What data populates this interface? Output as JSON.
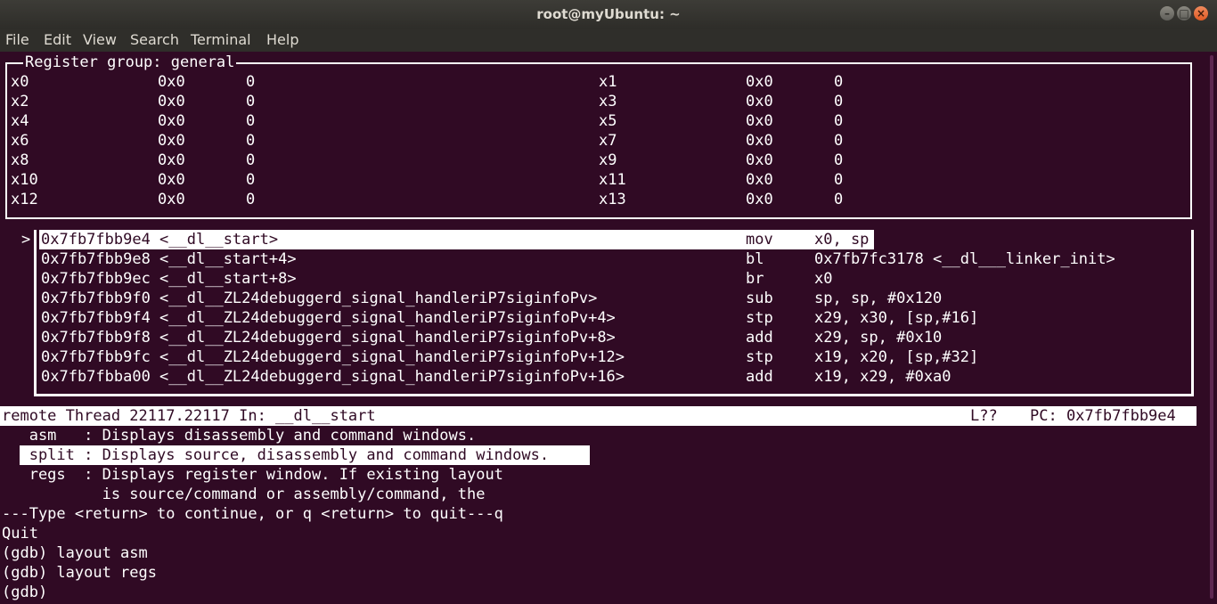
{
  "window": {
    "title": "root@myUbuntu: ~",
    "buttons": [
      "–",
      "□",
      "×"
    ]
  },
  "menu": [
    "File",
    "Edit",
    "View",
    "Search",
    "Terminal",
    "Help"
  ],
  "registers": {
    "title": "Register group: general",
    "rows": [
      {
        "l_name": "x0",
        "l_hex": "0x0",
        "l_dec": "0",
        "r_name": "x1",
        "r_hex": "0x0",
        "r_dec": "0"
      },
      {
        "l_name": "x2",
        "l_hex": "0x0",
        "l_dec": "0",
        "r_name": "x3",
        "r_hex": "0x0",
        "r_dec": "0"
      },
      {
        "l_name": "x4",
        "l_hex": "0x0",
        "l_dec": "0",
        "r_name": "x5",
        "r_hex": "0x0",
        "r_dec": "0"
      },
      {
        "l_name": "x6",
        "l_hex": "0x0",
        "l_dec": "0",
        "r_name": "x7",
        "r_hex": "0x0",
        "r_dec": "0"
      },
      {
        "l_name": "x8",
        "l_hex": "0x0",
        "l_dec": "0",
        "r_name": "x9",
        "r_hex": "0x0",
        "r_dec": "0"
      },
      {
        "l_name": "x10",
        "l_hex": "0x0",
        "l_dec": "0",
        "r_name": "x11",
        "r_hex": "0x0",
        "r_dec": "0"
      },
      {
        "l_name": "x12",
        "l_hex": "0x0",
        "l_dec": "0",
        "r_name": "x13",
        "r_hex": "0x0",
        "r_dec": "0"
      }
    ]
  },
  "asm": {
    "marker": ">",
    "rows": [
      {
        "addr": "0x7fb7fbb9e4 <__dl__start>",
        "op": "mov",
        "args": "x0, sp"
      },
      {
        "addr": "0x7fb7fbb9e8 <__dl__start+4>",
        "op": "bl",
        "args": "0x7fb7fc3178 <__dl___linker_init>"
      },
      {
        "addr": "0x7fb7fbb9ec <__dl__start+8>",
        "op": "br",
        "args": "x0"
      },
      {
        "addr": "0x7fb7fbb9f0 <__dl__ZL24debuggerd_signal_handleriP7siginfoPv>",
        "op": "sub",
        "args": "sp, sp, #0x120"
      },
      {
        "addr": "0x7fb7fbb9f4 <__dl__ZL24debuggerd_signal_handleriP7siginfoPv+4>",
        "op": "stp",
        "args": "x29, x30, [sp,#16]"
      },
      {
        "addr": "0x7fb7fbb9f8 <__dl__ZL24debuggerd_signal_handleriP7siginfoPv+8>",
        "op": "add",
        "args": "x29, sp, #0x10"
      },
      {
        "addr": "0x7fb7fbb9fc <__dl__ZL24debuggerd_signal_handleriP7siginfoPv+12>",
        "op": "stp",
        "args": "x19, x20, [sp,#32]"
      },
      {
        "addr": "0x7fb7fbba00 <__dl__ZL24debuggerd_signal_handleriP7siginfoPv+16>",
        "op": "add",
        "args": "x19, x29, #0xa0"
      }
    ]
  },
  "status": {
    "left": "remote Thread 22117.22117 In: __dl__start",
    "line": "L??",
    "pc": "PC: 0x7fb7fbb9e4"
  },
  "console": [
    "   asm   : Displays disassembly and command windows.",
    "   split : Displays source, disassembly and command windows.",
    "   regs  : Displays register window. If existing layout",
    "           is source/command or assembly/command, the",
    "---Type <return> to continue, or q <return> to quit---q",
    "Quit",
    "(gdb) layout asm",
    "(gdb) layout regs",
    "(gdb) "
  ]
}
